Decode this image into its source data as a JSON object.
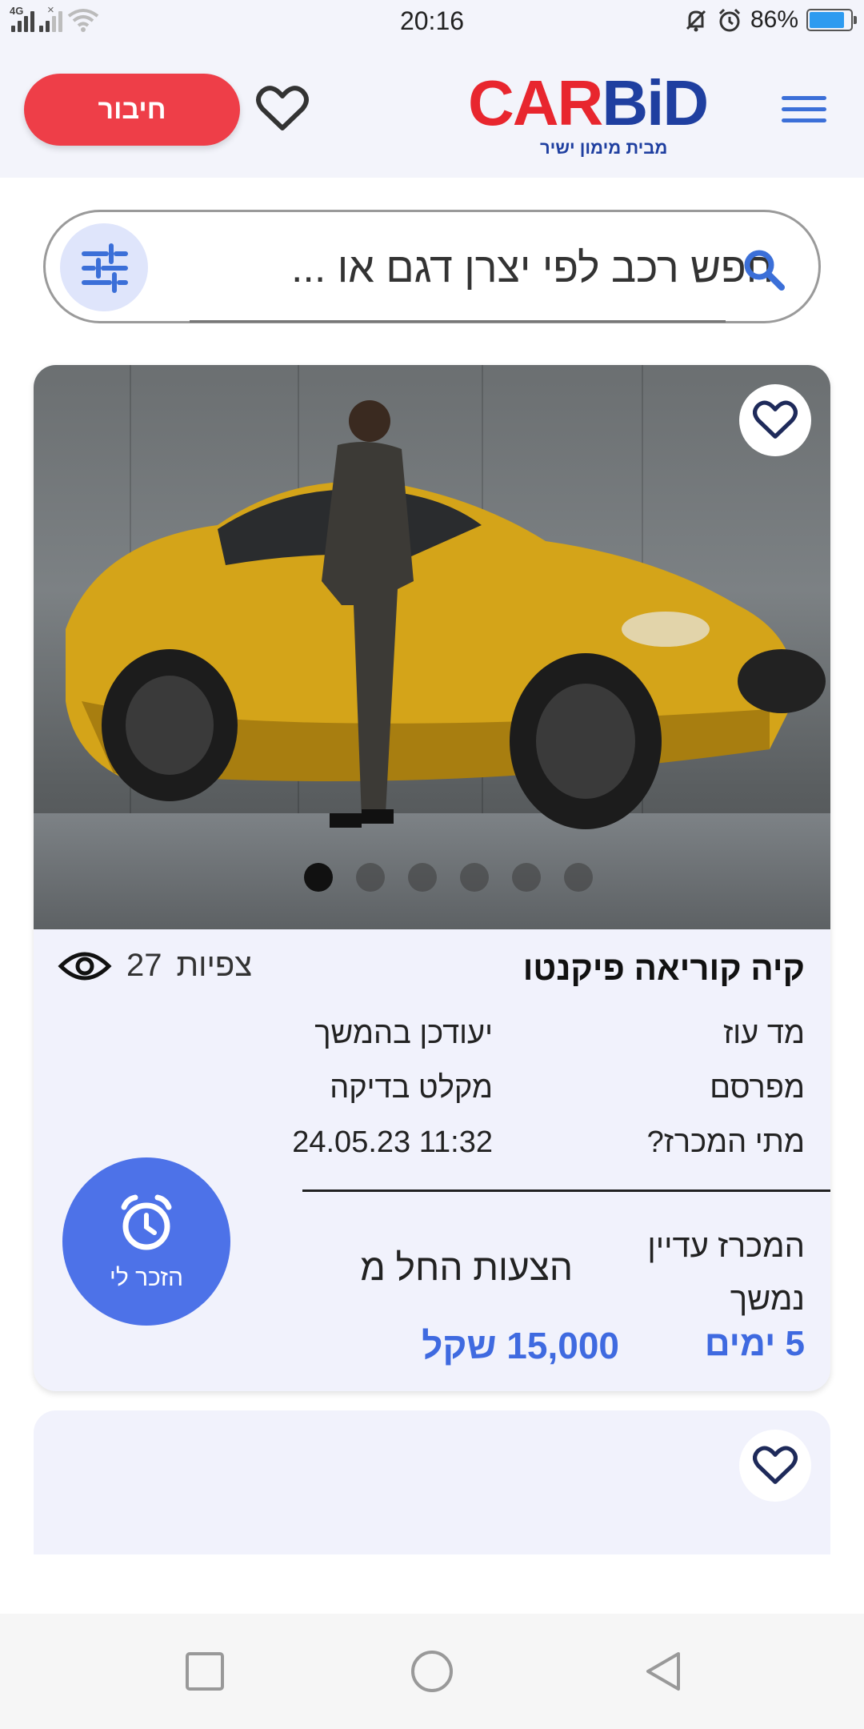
{
  "status_bar": {
    "network": "4G",
    "time": "20:16",
    "battery": "86%",
    "battery_level": 0.86
  },
  "header": {
    "login_label": "חיבור",
    "logo_part1": "CAR",
    "logo_part2": "BiD",
    "logo_tagline": "מבית מימון ישיר",
    "colors": {
      "brand_red": "#e8262e",
      "brand_blue": "#1f3fa0",
      "accent_blue": "#3f6ae0"
    }
  },
  "search": {
    "placeholder": "חפש רכב לפי יצרן דגם או ..."
  },
  "listing": {
    "title": "קיה קוריאה פיקנטו",
    "views_count": "27",
    "views_label": "צפיות",
    "image_count": 6,
    "active_image": 1,
    "rows": [
      {
        "label": "מד עוז",
        "value": "יעודכן בהמשך"
      },
      {
        "label": "מפרסם",
        "value": "מקלט בדיקה"
      },
      {
        "label": "מתי המכרז?",
        "value": "11:32 24.05.23"
      }
    ],
    "auction_status": "המכרז עדיין נמשך",
    "offers_label": "הצעות החל מ",
    "days_left": "5 ימים",
    "price": "15,000 שקל",
    "remind_label": "הזכר לי"
  }
}
